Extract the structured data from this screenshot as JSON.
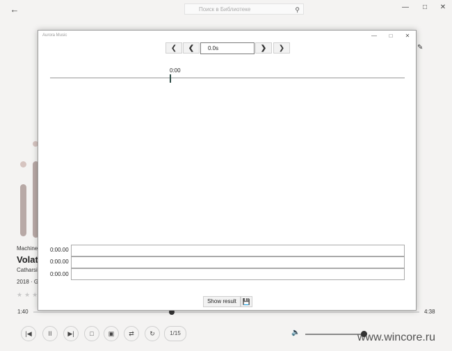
{
  "app": {
    "search": {
      "placeholder": "Поиск в Библиотеке"
    },
    "track": {
      "artist": "Machine",
      "title": "Volat",
      "album": "Catharsis",
      "year_info": "2018 · G"
    },
    "player": {
      "elapsed": "1:40",
      "duration": "4:38",
      "progress": 0.36,
      "track_counter": "1/15",
      "volume": 0.92
    },
    "watermark": "www.wincore.ru"
  },
  "dialog": {
    "title": "Aurora Music",
    "time_value": "0.0s",
    "timeline_label": "0:00",
    "rows": [
      {
        "time": "0:00.00"
      },
      {
        "time": "0:00.00"
      },
      {
        "time": "0:00.00"
      }
    ],
    "show_result_label": "Show result"
  },
  "icons": {
    "back": "back-arrow-icon",
    "search": "search-icon",
    "save": "save-icon"
  }
}
